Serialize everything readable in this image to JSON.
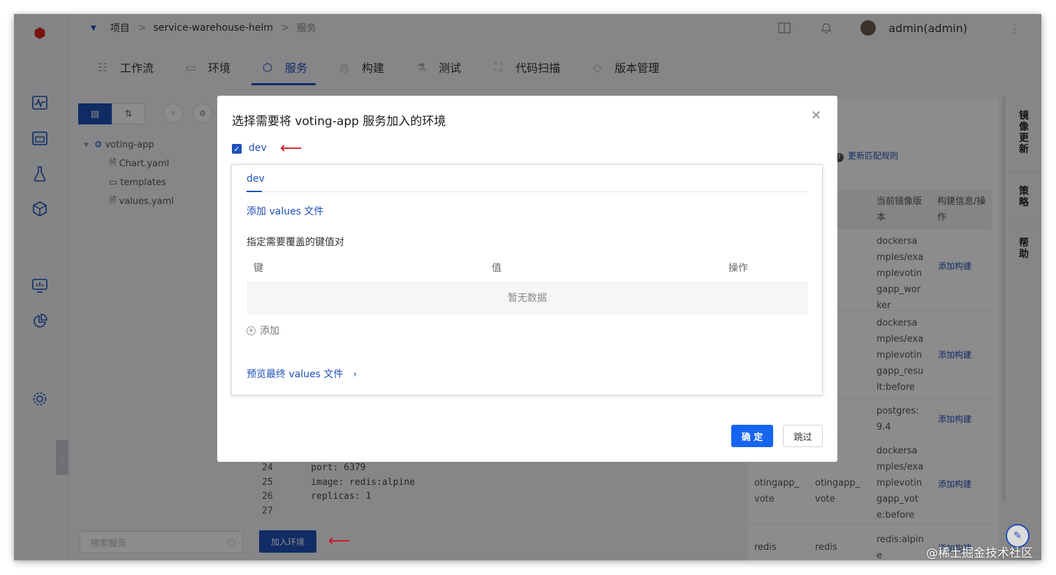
{
  "breadcrumb": {
    "project": "项目",
    "service_name": "service-warehouse-helm",
    "page": "服务",
    "separator": ">"
  },
  "header": {
    "user": "admin(admin)"
  },
  "tabs": [
    {
      "label": "工作流",
      "icon": "workflow-icon"
    },
    {
      "label": "环境",
      "icon": "environment-icon"
    },
    {
      "label": "服务",
      "icon": "service-icon",
      "active": true
    },
    {
      "label": "构建",
      "icon": "build-icon"
    },
    {
      "label": "测试",
      "icon": "test-icon"
    },
    {
      "label": "代码扫描",
      "icon": "scan-icon"
    },
    {
      "label": "版本管理",
      "icon": "version-icon"
    }
  ],
  "tree": {
    "root": "voting-app",
    "items": [
      "Chart.yaml",
      "templates",
      "values.yaml"
    ]
  },
  "search": {
    "placeholder": "搜索服务"
  },
  "code": {
    "lines": [
      {
        "num": "24",
        "text": "    port: 6379"
      },
      {
        "num": "25",
        "text": "    image: redis:alpine"
      },
      {
        "num": "26",
        "text": "    replicas: 1"
      },
      {
        "num": "27",
        "text": ""
      }
    ]
  },
  "join_env_button": "加入环境",
  "right_panel": {
    "update_rule": "更新匹配规则",
    "header_col_current_image": "当前镜像版本",
    "header_col_build": "构建信息/操作",
    "rows": [
      {
        "image": "dockersamples/examplevotingapp_worker",
        "action": "添加构建"
      },
      {
        "image": "dockersamples/examplevotingapp_result:before",
        "action": "添加构建"
      },
      {
        "image": "postgres:9.4",
        "action": "添加构建"
      },
      {
        "name": "otingapp_vote",
        "container": "otingapp_vote",
        "image": "dockersamples/examplevotingapp_vote:before",
        "action": "添加构建"
      },
      {
        "name": "redis",
        "container": "redis",
        "image": "redis:alpine",
        "action": "添加构建"
      }
    ]
  },
  "side_tabs": [
    "镜像更新",
    "策略",
    "帮助"
  ],
  "watermark": "@稀土掘金技术社区",
  "modal": {
    "title": "选择需要将 voting-app 服务加入的环境",
    "env_checkbox": {
      "label": "dev",
      "checked": true
    },
    "env_tab": "dev",
    "add_values_file": "添加 values 文件",
    "kv_title": "指定需要覆盖的键值对",
    "columns": {
      "key": "键",
      "value": "值",
      "action": "操作"
    },
    "empty": "暂无数据",
    "add": "添加",
    "preview": "预览最终 values 文件",
    "confirm": "确 定",
    "skip": "跳过"
  }
}
